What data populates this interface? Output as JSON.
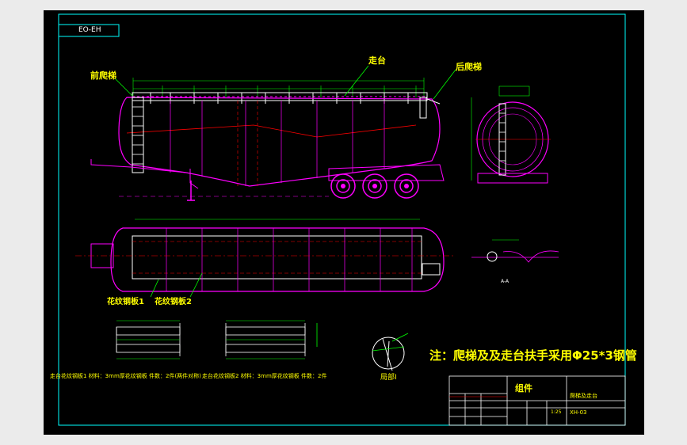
{
  "drawing": {
    "code_box": "ЕО-ЕН",
    "labels": {
      "front_ladder": "前爬梯",
      "walkway": "走台",
      "rear_ladder": "后爬梯",
      "plate1": "花纹钢板1",
      "plate2": "花纹钢板2",
      "detail": "局部I",
      "section": "A-A"
    },
    "note": "注：爬梯及及走台扶手采用Φ25*3钢管",
    "material_line": "走台花纹钢板1 材料：3mm厚花纹钢板 件数：2件(两件对称)",
    "material_line2": "走台花纹钢板2 材料：3mm厚花纹钢板 件数：2件"
  },
  "title_block": {
    "part_type": "组件",
    "part_name": "爬梯及走台",
    "drawing_no": "XH-03",
    "scale": "1:25"
  },
  "colors": {
    "background": "#000000",
    "frame": "#00ffff",
    "body": "#ff00ff",
    "hidden": "#ff0000",
    "text": "#ffff00",
    "dimension": "#00ff00"
  }
}
